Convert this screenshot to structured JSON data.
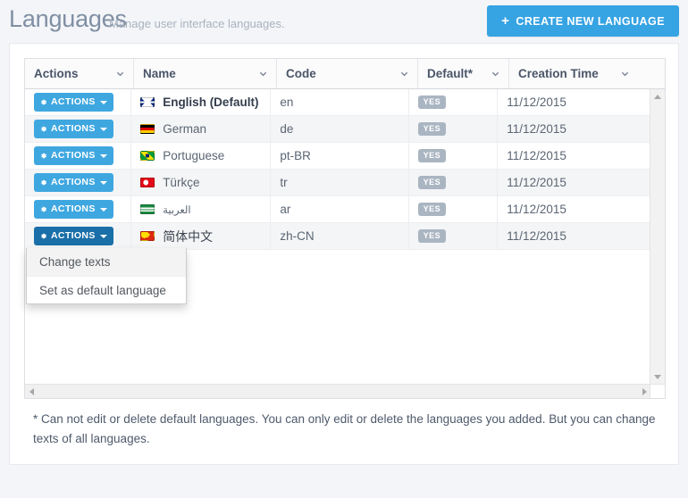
{
  "header": {
    "title": "Languages",
    "subtitle": "Manage user interface languages.",
    "create_button": "CREATE NEW LANGUAGE",
    "create_icon": "plus-icon",
    "accent_color": "#36a3e3"
  },
  "grid": {
    "columns": [
      {
        "label": "Actions",
        "sort_icon": "chevron-down-icon"
      },
      {
        "label": "Name",
        "sort_icon": "chevron-down-icon"
      },
      {
        "label": "Code",
        "sort_icon": "chevron-down-icon"
      },
      {
        "label": "Default*",
        "sort_icon": "chevron-down-icon"
      },
      {
        "label": "Creation Time",
        "sort_icon": "chevron-down-icon"
      }
    ],
    "action_button_label": "ACTIONS",
    "action_button_icon": "gear-icon",
    "action_button_caret": "caret-down-icon",
    "rows": [
      {
        "flag": "flag-uk-icon",
        "name": "English (Default)",
        "code": "en",
        "default": "YES",
        "creation_time": "11/12/2015"
      },
      {
        "flag": "flag-germany-icon",
        "name": "German",
        "code": "de",
        "default": "YES",
        "creation_time": "11/12/2015"
      },
      {
        "flag": "flag-brazil-icon",
        "name": "Portuguese",
        "code": "pt-BR",
        "default": "YES",
        "creation_time": "11/12/2015"
      },
      {
        "flag": "flag-turkey-icon",
        "name": "Türkçe",
        "code": "tr",
        "default": "YES",
        "creation_time": "11/12/2015"
      },
      {
        "flag": "flag-saudi-icon",
        "name": "العربية",
        "code": "ar",
        "default": "YES",
        "creation_time": "11/12/2015"
      },
      {
        "flag": "flag-china-icon",
        "name": "简体中文",
        "code": "zh-CN",
        "default": "YES",
        "creation_time": "11/12/2015"
      }
    ],
    "badge_color": "#aab5c2",
    "scrollbar": {
      "vertical_up_icon": "arrow-up-icon",
      "vertical_down_icon": "arrow-down-icon",
      "horizontal_left_icon": "arrow-left-icon",
      "horizontal_right_icon": "arrow-right-icon"
    }
  },
  "dropdown": {
    "open": true,
    "items": [
      {
        "label": "Change texts",
        "hovered": true
      },
      {
        "label": "Set as default language",
        "hovered": false
      }
    ]
  },
  "footnote": "* Can not edit or delete default languages. You can only edit or delete the languages you added. But you can change texts of all languages."
}
